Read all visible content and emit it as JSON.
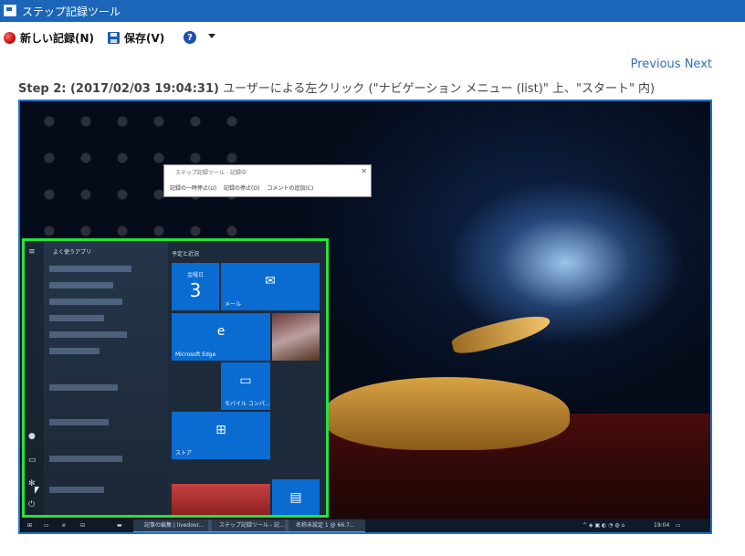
{
  "window": {
    "title": "ステップ記録ツール",
    "icon": "app-icon"
  },
  "toolbar": {
    "new_label": "新しい記録(N)",
    "save_label": "保存(V)",
    "help_glyph": "?",
    "menu_caret": "▾"
  },
  "nav": {
    "previous": "Previous",
    "next": "Next"
  },
  "step": {
    "id": "Step 2: (2017/02/03 19:04:31)",
    "description": "ユーザーによる左クリック (\"ナビゲーション メニュー (list)\" 上、\"スタート\" 内)"
  },
  "screenshot": {
    "steps_recorder": {
      "title": "ステップ記録ツール - 記録中",
      "pause": "記録の一時停止(U)",
      "stop": "記録の停止(O)",
      "comment": "コメントの追加(C)",
      "close": "✕"
    },
    "start_menu": {
      "frequent_header": "よく使うアプリ",
      "schedule_header": "予定と近況",
      "tiles": {
        "calendar_day": "金曜日",
        "calendar_date": "3",
        "mail": "メール",
        "edge": "Microsoft Edge",
        "mobile": "モバイル コンパ...",
        "store": "ストア"
      }
    },
    "taskbar": {
      "app1": "記事の編集 | livedoor...",
      "app2": "ステップ記録ツール - 記...",
      "app3": "名称未設定 1 @ 66.7...",
      "time": "19:04"
    }
  },
  "colors": {
    "highlight": "#22e53a",
    "frame_border": "#1f72c9",
    "titlebar": "#1b66b8",
    "link": "#2f6ebf"
  }
}
